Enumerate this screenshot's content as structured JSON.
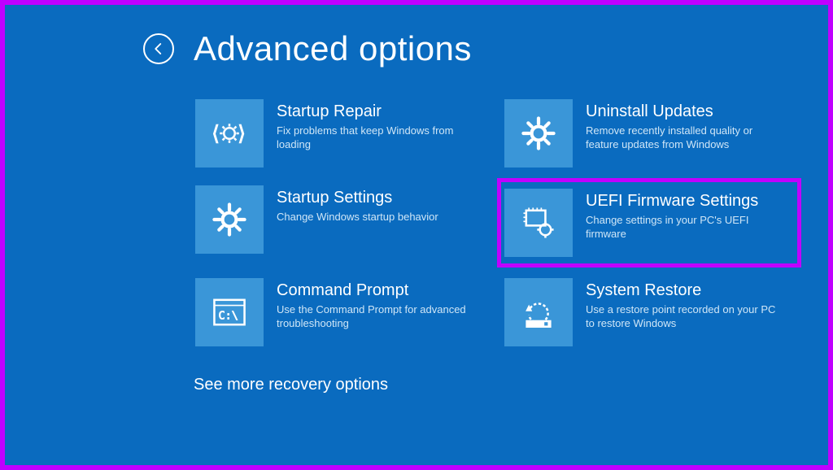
{
  "header": {
    "title": "Advanced options"
  },
  "tiles": {
    "startup_repair": {
      "title": "Startup Repair",
      "desc": "Fix problems that keep Windows from loading"
    },
    "uninstall_updates": {
      "title": "Uninstall Updates",
      "desc": "Remove recently installed quality or feature updates from Windows"
    },
    "startup_settings": {
      "title": "Startup Settings",
      "desc": "Change Windows startup behavior"
    },
    "uefi": {
      "title": "UEFI Firmware Settings",
      "desc": "Change settings in your PC's UEFI firmware"
    },
    "command_prompt": {
      "title": "Command Prompt",
      "desc": "Use the Command Prompt for advanced troubleshooting"
    },
    "system_restore": {
      "title": "System Restore",
      "desc": "Use a restore point recorded on your PC to restore Windows"
    }
  },
  "more_link": "See more recovery options",
  "colors": {
    "background": "#0a6bbf",
    "tile_bg": "#3a96d8",
    "highlight": "#c000ff"
  }
}
